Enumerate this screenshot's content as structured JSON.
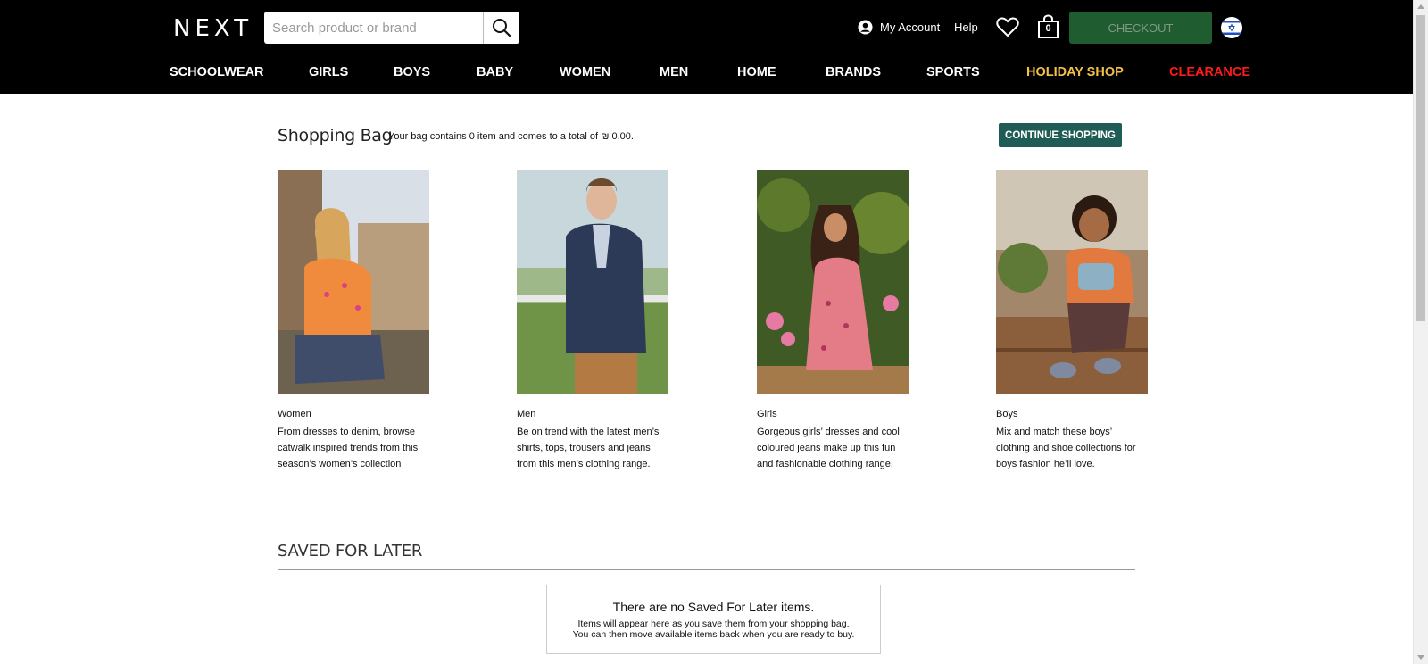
{
  "header": {
    "logo": "NEXT",
    "search_placeholder": "Search product or brand",
    "my_account": "My Account",
    "help": "Help",
    "bag_count": "0",
    "checkout": "CHECKOUT"
  },
  "nav": [
    {
      "label": "SCHOOLWEAR",
      "color": "#ffffff"
    },
    {
      "label": "GIRLS",
      "color": "#ffffff"
    },
    {
      "label": "BOYS",
      "color": "#ffffff"
    },
    {
      "label": "BABY",
      "color": "#ffffff"
    },
    {
      "label": "WOMEN",
      "color": "#ffffff"
    },
    {
      "label": "MEN",
      "color": "#ffffff"
    },
    {
      "label": "HOME",
      "color": "#ffffff"
    },
    {
      "label": "BRANDS",
      "color": "#ffffff"
    },
    {
      "label": "SPORTS",
      "color": "#ffffff"
    },
    {
      "label": "HOLIDAY SHOP",
      "color": "#f5c04a"
    },
    {
      "label": "CLEARANCE",
      "color": "#ff1a1a"
    }
  ],
  "bag": {
    "title": "Shopping Bag",
    "summary": "Your bag contains 0 item and comes to a total of ₪ 0.00.",
    "continue": "CONTINUE SHOPPING"
  },
  "cards": [
    {
      "name": "Women",
      "desc": "From dresses to denim, browse catwalk inspired trends from this season’s women’s collection"
    },
    {
      "name": "Men",
      "desc": "Be on trend with the latest men’s shirts, tops, trousers and jeans from this men’s clothing range."
    },
    {
      "name": "Girls",
      "desc": "Gorgeous girls’ dresses and cool coloured jeans make up this fun and fashionable clothing range."
    },
    {
      "name": "Boys",
      "desc": "Mix and match these boys’ clothing and shoe collections for boys fashion he’ll love."
    }
  ],
  "saved": {
    "title": "SAVED FOR LATER",
    "empty_title": "There are no Saved For Later items.",
    "empty_line1": "Items will appear here as you save them from your shopping bag.",
    "empty_line2": "You can then move available items back when you are ready to buy."
  },
  "colors": {
    "checkout_bg": "#1f5c2f",
    "continue_bg": "#1f5c55",
    "holiday": "#f5c04a",
    "clearance": "#ff1a1a"
  }
}
